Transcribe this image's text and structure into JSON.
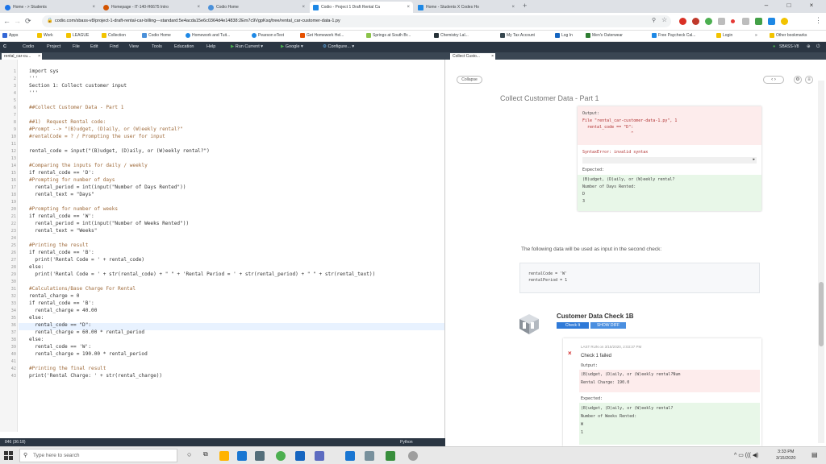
{
  "browser": {
    "tabs": [
      {
        "label": "Home - > Students",
        "color": "#1a73e8"
      },
      {
        "label": "Homepage - IT-140-H6675 Intro",
        "color": "#d35400"
      },
      {
        "label": "Codio Home",
        "color": "#4a90d9"
      },
      {
        "label": "Codio - Project 1 Draft Rental Ca",
        "color": "#1e88e5"
      },
      {
        "label": "Home - Students X Codes Ho",
        "color": "#1e88e5"
      }
    ],
    "new_tab": "+",
    "window_controls": [
      "–",
      "□",
      "×"
    ],
    "url": "codio.com/sbass-v8/project-1-draft-rental-car-billing---standard:5e4acda15e6c0364d4e14838:2Em7c9VgpKsq/tree/rental_car-customer-data-1.py",
    "bookmarks": [
      "Apps",
      "Work",
      "LEAGUE",
      "Collection",
      "Codio Home",
      "Homework and Tuit...",
      "Pearson eText",
      "Get Homework Hel...",
      "Springs at South Br...",
      "Chemistry Lal...",
      "My Tax Account",
      "Log In",
      "Men's Outerwear",
      "Free Paycheck Cal...",
      "Login",
      "»",
      "Other bookmarks"
    ]
  },
  "menubar": {
    "items": [
      "Codio",
      "Project",
      "File",
      "Edit",
      "Find",
      "View",
      "Tools",
      "Education",
      "Help"
    ],
    "run_current": "Run Current",
    "google": "Google",
    "configure": "Configure...",
    "user": "SBASS-V8"
  },
  "editor": {
    "tab": "rental_car-cu...",
    "lines": [
      "import sys",
      "'''",
      "Section 1: Collect customer input",
      "'''",
      "",
      "##Collect Customer Data - Part 1",
      "",
      "##1)  Request Rental code:",
      "#Prompt --> \"(B)udget, (D)aily, or (W)eekly rental?\"",
      "#rentalCode = ? / Prompting the user for input",
      "",
      "rental_code = input(\"(B)udget, (D)aily, or (W)eekly rental?\")",
      "",
      "#Comparing the inputs for daily / weekly",
      "if rental_code == 'D':",
      "#Prompting for number of days",
      "  rental_period = int(input(\"Number of Days Rented\"))",
      "  rental_text = \"Days\"",
      "",
      "#Prompting for number of weeks",
      "if rental_code == 'W':",
      "  rental_period = int(input(\"Number of Weeks Rented\"))",
      "  rental_text = \"Weeks\"",
      "",
      "#Printing the result",
      "if rental_code == 'B':",
      "  print('Rental Code = ' + rental_code)",
      "else:",
      "  print('Rental Code = ' + str(rental_code) + \" \" + 'Rental Period = ' + str(rental_period) + \" \" + str(rental_text))",
      "",
      "#Calculations/Base Charge For Rental",
      "rental_charge = 0",
      "if rental_code == 'B':",
      "  rental_charge = 40.00",
      "else:",
      "  rental_code == \"D\":",
      "  rental_charge = 60.00 * rental_period",
      "else:",
      "  rental_code == 'W':",
      "  rental_charge = 190.00 * rental_period",
      "",
      "#Printing the final result",
      "print('Rental Charge: ' + str(rental_charge))"
    ],
    "status_left": "846 (36:18)",
    "status_right": "Python"
  },
  "guide": {
    "tab": "Collect Custo...",
    "collapse": "Collapse",
    "title": "Collect Customer Data - Part 1",
    "output_label": "Output:",
    "output_lines": [
      "File \"rental_car-customer-data-1.py\", 1",
      "  rental_code == \"D\":",
      "                    ^",
      "SyntaxError: invalid syntax"
    ],
    "expected_label": "Expected:",
    "expected_lines": [
      "(B)udget, (D)aily, or (W)eekly rental?",
      "Number of Days Rented:",
      "D",
      "3"
    ],
    "second_check_text": "The following data will be used as input in the second check:",
    "second_check_code": [
      "rentalCode = 'W'",
      "rentalPeriod = 1"
    ],
    "check_title": "Customer Data Check 1B",
    "check_button": "Check It",
    "show_diff": "SHOW DIFF",
    "last_run": "LAST RUN on 3/15/2020, 2:03:37 PM",
    "fail_text": "Check 1 failed",
    "output2_label": "Output:",
    "output2_lines": [
      "(B)udget, (D)aily, or (W)eekly rental?Num",
      "Rental Charge: 190.0"
    ],
    "expected2_label": "Expected:",
    "expected2_lines": [
      "(B)udget, (D)aily, or (W)eekly rental?",
      "Number of Weeks Rented:",
      "W",
      "1"
    ]
  },
  "taskbar": {
    "search": "Type here to search",
    "time": "3:33 PM",
    "date": "3/15/2020"
  }
}
